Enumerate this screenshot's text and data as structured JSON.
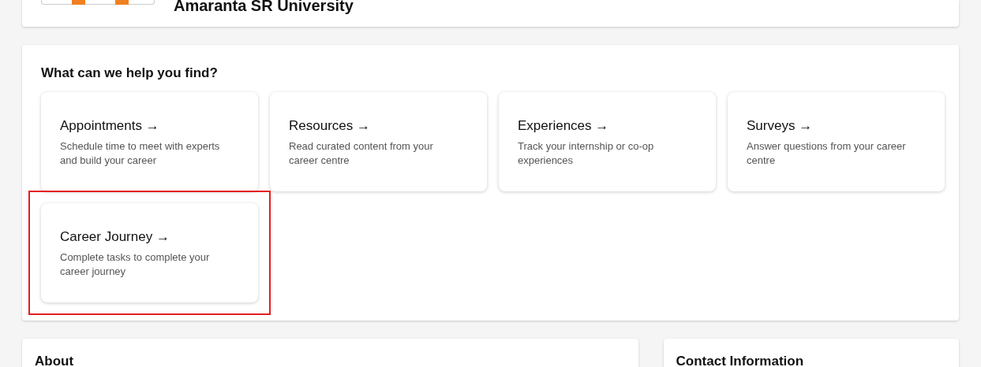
{
  "header": {
    "title": "Amaranta SR University"
  },
  "finder": {
    "heading": "What can we help you find?",
    "cards": [
      {
        "title": "Appointments →",
        "description": "Schedule time to meet with experts and build your career",
        "highlighted": false
      },
      {
        "title": "Resources →",
        "description": "Read curated content from your career centre",
        "highlighted": false
      },
      {
        "title": "Experiences →",
        "description": "Track your internship or co-op experiences",
        "highlighted": false
      },
      {
        "title": "Surveys →",
        "description": "Answer questions from your career centre",
        "highlighted": false
      },
      {
        "title": "Career Journey →",
        "description": "Complete tasks to complete your career journey",
        "highlighted": true
      }
    ]
  },
  "about": {
    "heading": "About"
  },
  "contact": {
    "heading": "Contact Information"
  }
}
